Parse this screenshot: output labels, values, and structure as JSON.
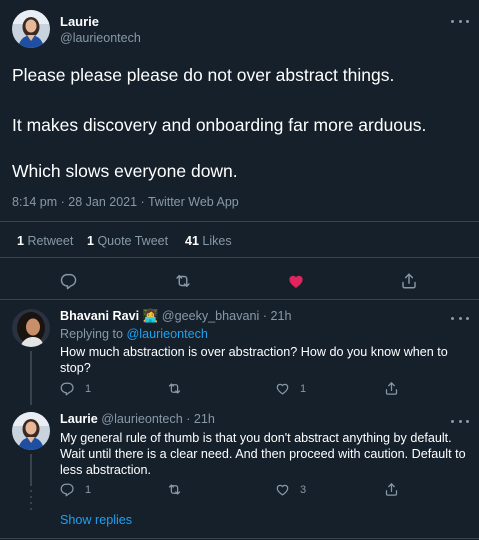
{
  "main_tweet": {
    "author_name": "Laurie",
    "author_handle": "@laurieontech",
    "paragraphs": [
      "Please please please do not over abstract things.",
      "It makes discovery and onboarding far more arduous.",
      "Which slows everyone down."
    ],
    "meta": "8:14 pm · 28 Jan 2021 · Twitter Web App",
    "stats": {
      "retweets_count": "1",
      "retweets_label": "Retweet",
      "quote_count": "1",
      "quote_label": "Quote Tweet",
      "likes_count": "41",
      "likes_label": "Likes"
    },
    "liked": true
  },
  "replies": [
    {
      "author_name": "Bhavani Ravi",
      "badge_emoji": "👩‍💻",
      "author_handle": "@geeky_bhavani",
      "time": "· 21h",
      "replying_prefix": "Replying to",
      "replying_to": "@laurieontech",
      "text": "How much abstraction is over abstraction? How do you know when to stop?",
      "reply_count": "1",
      "retweet_count": "",
      "like_count": "1"
    },
    {
      "author_name": "Laurie",
      "author_handle": "@laurieontech",
      "time": "· 21h",
      "text": "My general rule of thumb is that you don't abstract anything by default. Wait until there is a clear need. And then proceed with caution. Default to less abstraction.",
      "reply_count": "1",
      "retweet_count": "",
      "like_count": "3"
    }
  ],
  "show_replies_label": "Show replies",
  "colors": {
    "background": "#15202b",
    "divider": "#38444d",
    "muted": "#8899a6",
    "link": "#1da1f2",
    "like_active": "#e0245e"
  }
}
